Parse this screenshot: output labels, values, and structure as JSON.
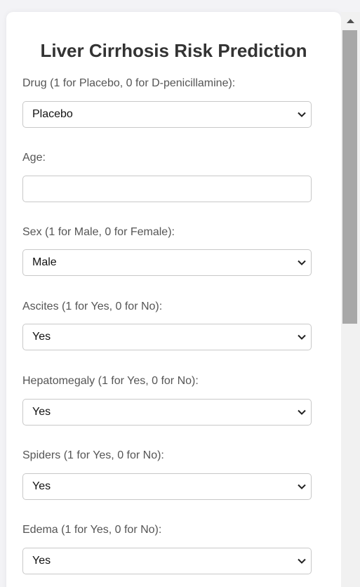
{
  "form": {
    "title": "Liver Cirrhosis Risk Prediction",
    "fields": [
      {
        "label": "Drug (1 for Placebo, 0 for D-penicillamine):",
        "type": "select",
        "value": "Placebo"
      },
      {
        "label": "Age:",
        "type": "input",
        "value": ""
      },
      {
        "label": "Sex (1 for Male, 0 for Female):",
        "type": "select",
        "value": "Male"
      },
      {
        "label": "Ascites (1 for Yes, 0 for No):",
        "type": "select",
        "value": "Yes"
      },
      {
        "label": "Hepatomegaly (1 for Yes, 0 for No):",
        "type": "select",
        "value": "Yes"
      },
      {
        "label": "Spiders (1 for Yes, 0 for No):",
        "type": "select",
        "value": "Yes"
      },
      {
        "label": "Edema (1 for Yes, 0 for No):",
        "type": "select",
        "value": "Yes"
      }
    ]
  },
  "icons": {
    "select_arrow": "chevron-down-icon",
    "scroll_up": "scroll-up-arrow-icon"
  },
  "colors": {
    "background": "#f3f3f6",
    "card": "#ffffff",
    "title": "#333333",
    "label": "#555555",
    "border": "#c8c8c8",
    "scroll_thumb": "#a8a8a8"
  }
}
